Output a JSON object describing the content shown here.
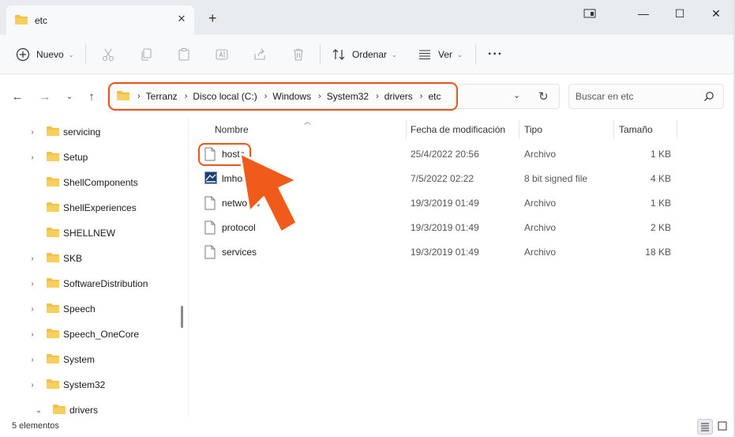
{
  "window": {
    "tab_title": "etc",
    "new_tab_symbol": "+",
    "tab_close_symbol": "✕",
    "controls": {
      "minimize": "—",
      "maximize": "☐",
      "close": "✕"
    }
  },
  "toolbar": {
    "new_label": "Nuevo",
    "sort_label": "Ordenar",
    "view_label": "Ver",
    "more_symbol": "···",
    "icons": [
      "plus-circle-icon",
      "cut-icon",
      "copy-icon",
      "paste-icon",
      "rename-icon",
      "share-icon",
      "delete-icon",
      "sort-icon",
      "view-icon"
    ]
  },
  "address": {
    "crumbs": [
      "Terranz",
      "Disco local (C:)",
      "Windows",
      "System32",
      "drivers",
      "etc"
    ]
  },
  "search": {
    "placeholder": "Buscar en etc"
  },
  "sidebar": {
    "items": [
      {
        "label": "servicing",
        "expandable": true
      },
      {
        "label": "Setup",
        "expandable": true
      },
      {
        "label": "ShellComponents",
        "expandable": false
      },
      {
        "label": "ShellExperiences",
        "expandable": false
      },
      {
        "label": "SHELLNEW",
        "expandable": false
      },
      {
        "label": "SKB",
        "expandable": true
      },
      {
        "label": "SoftwareDistribution",
        "expandable": true
      },
      {
        "label": "Speech",
        "expandable": true
      },
      {
        "label": "Speech_OneCore",
        "expandable": true
      },
      {
        "label": "System",
        "expandable": true
      },
      {
        "label": "System32",
        "expandable": true
      },
      {
        "label": "drivers",
        "expandable": true,
        "expanded": true
      }
    ]
  },
  "columns": {
    "name": "Nombre",
    "date": "Fecha de modificación",
    "type": "Tipo",
    "size": "Tamaño"
  },
  "files": [
    {
      "name": "hosts",
      "date": "25/4/2022 20:56",
      "type": "Archivo",
      "size": "1 KB",
      "icon": "file-icon"
    },
    {
      "name": "lmhosts",
      "date": "7/5/2022 02:22",
      "type": "8 bit signed file",
      "size": "4 KB",
      "icon": "app-file-icon"
    },
    {
      "name": "networks",
      "date": "19/3/2019 01:49",
      "type": "Archivo",
      "size": "1 KB",
      "icon": "file-icon"
    },
    {
      "name": "protocol",
      "date": "19/3/2019 01:49",
      "type": "Archivo",
      "size": "2 KB",
      "icon": "file-icon"
    },
    {
      "name": "services",
      "date": "19/3/2019 01:49",
      "type": "Archivo",
      "size": "18 KB",
      "icon": "file-icon"
    }
  ],
  "status": {
    "count_text": "5 elementos"
  },
  "colors": {
    "highlight": "#e8561c",
    "folder": "#f3c04a"
  }
}
